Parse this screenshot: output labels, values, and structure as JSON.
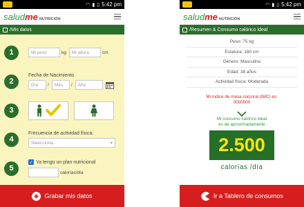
{
  "status": {
    "time": "5:42 pm"
  },
  "brand": {
    "salud": "salud",
    "me": "me",
    "nutricion": "NUTRICIÓN"
  },
  "left": {
    "title": "/Mis datos",
    "peso_placeholder": "Mi peso",
    "peso_unit": "kg",
    "altura_placeholder": "Mi altura",
    "altura_unit": "cm",
    "fecha_label": "Fecha de Nacimiento",
    "dia": "Día",
    "mes": "Mes",
    "anio": "Año",
    "slash": "/",
    "actividad_label": "Frecuencia de actividad física:",
    "actividad_value": "Selecciona...",
    "plan_label": "Ya tengo un plan nutricional",
    "calorias_unit": "calorías/día",
    "button": "Grabar mis datos",
    "steps": [
      "1",
      "2",
      "3",
      "4",
      "5"
    ]
  },
  "right": {
    "title": "/Resumen & Consumo calórico ideal",
    "rows": [
      "Peso: 75 kg",
      "Estatura: 180 cm",
      "Género: Masculino",
      "Edad: 38 años",
      "Actividad física: Moderada"
    ],
    "imc_line1": "Mi índice de masa corporal (IMC) es:",
    "imc_value": "0000000",
    "consumo_line1": "Mi consumo calórico ideal",
    "consumo_line2": "es de aproximadamente",
    "calorias_value": "2.500",
    "calorias_label": "calorías /día",
    "button": "Ir a Tablero de consumos"
  }
}
